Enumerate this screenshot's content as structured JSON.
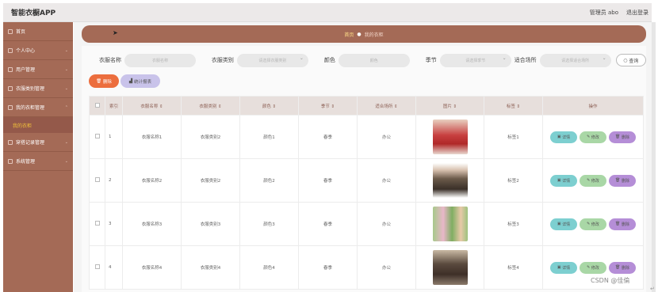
{
  "app_title": "智能衣橱APP",
  "top_right": {
    "user": "管理员 abo",
    "logout": "退出登录"
  },
  "sidebar": {
    "items": [
      {
        "label": "首页"
      },
      {
        "label": "个人中心"
      },
      {
        "label": "用户管理"
      },
      {
        "label": "衣服类别管理"
      },
      {
        "label": "我的衣柜管理"
      }
    ],
    "sub_item": "我的衣柜",
    "items_after": [
      {
        "label": "穿搭记录管理"
      },
      {
        "label": "系统管理"
      }
    ]
  },
  "breadcrumb": {
    "home": "首页",
    "current": "我的衣柜"
  },
  "search": {
    "name_label": "衣服名称",
    "name_placeholder": "衣服名称",
    "type_label": "衣服类别",
    "type_placeholder": "请选择衣服类别",
    "color_label": "颜色",
    "color_placeholder": "颜色",
    "season_label": "季节",
    "season_placeholder": "请选择季节",
    "occasion_label": "适合场所",
    "occasion_placeholder": "请选择适合场所",
    "search_button": "查询"
  },
  "actions": {
    "delete": "删除",
    "stats": "统计报表"
  },
  "table": {
    "headers": [
      "索引",
      "衣服名称 ⇕",
      "衣服类别 ⇕",
      "颜色 ⇕",
      "季节 ⇕",
      "适合场所 ⇕",
      "图片 ⇕",
      "标签 ⇕",
      "操作"
    ],
    "rows": [
      {
        "index": "1",
        "name": "衣服名称1",
        "type": "衣服类别2",
        "color": "颜色1",
        "season": "春季",
        "occasion": "办公",
        "tag": "标签1"
      },
      {
        "index": "2",
        "name": "衣服名称2",
        "type": "衣服类别2",
        "color": "颜色2",
        "season": "春季",
        "occasion": "办公",
        "tag": "标签2"
      },
      {
        "index": "3",
        "name": "衣服名称3",
        "type": "衣服类别3",
        "color": "颜色3",
        "season": "春季",
        "occasion": "办公",
        "tag": "标签3"
      },
      {
        "index": "4",
        "name": "衣服名称4",
        "type": "衣服类别4",
        "color": "颜色4",
        "season": "春季",
        "occasion": "办公",
        "tag": "标签4"
      }
    ],
    "op_labels": {
      "view": "详情",
      "edit": "修改",
      "delete": "删除"
    }
  },
  "watermark": "CSDN @佳倫",
  "colors": {
    "sidebar": "#a46a56",
    "delete": "#ec6e3e",
    "view": "#7dcfd0",
    "edit": "#a9d7a6",
    "del": "#b58ed7"
  }
}
